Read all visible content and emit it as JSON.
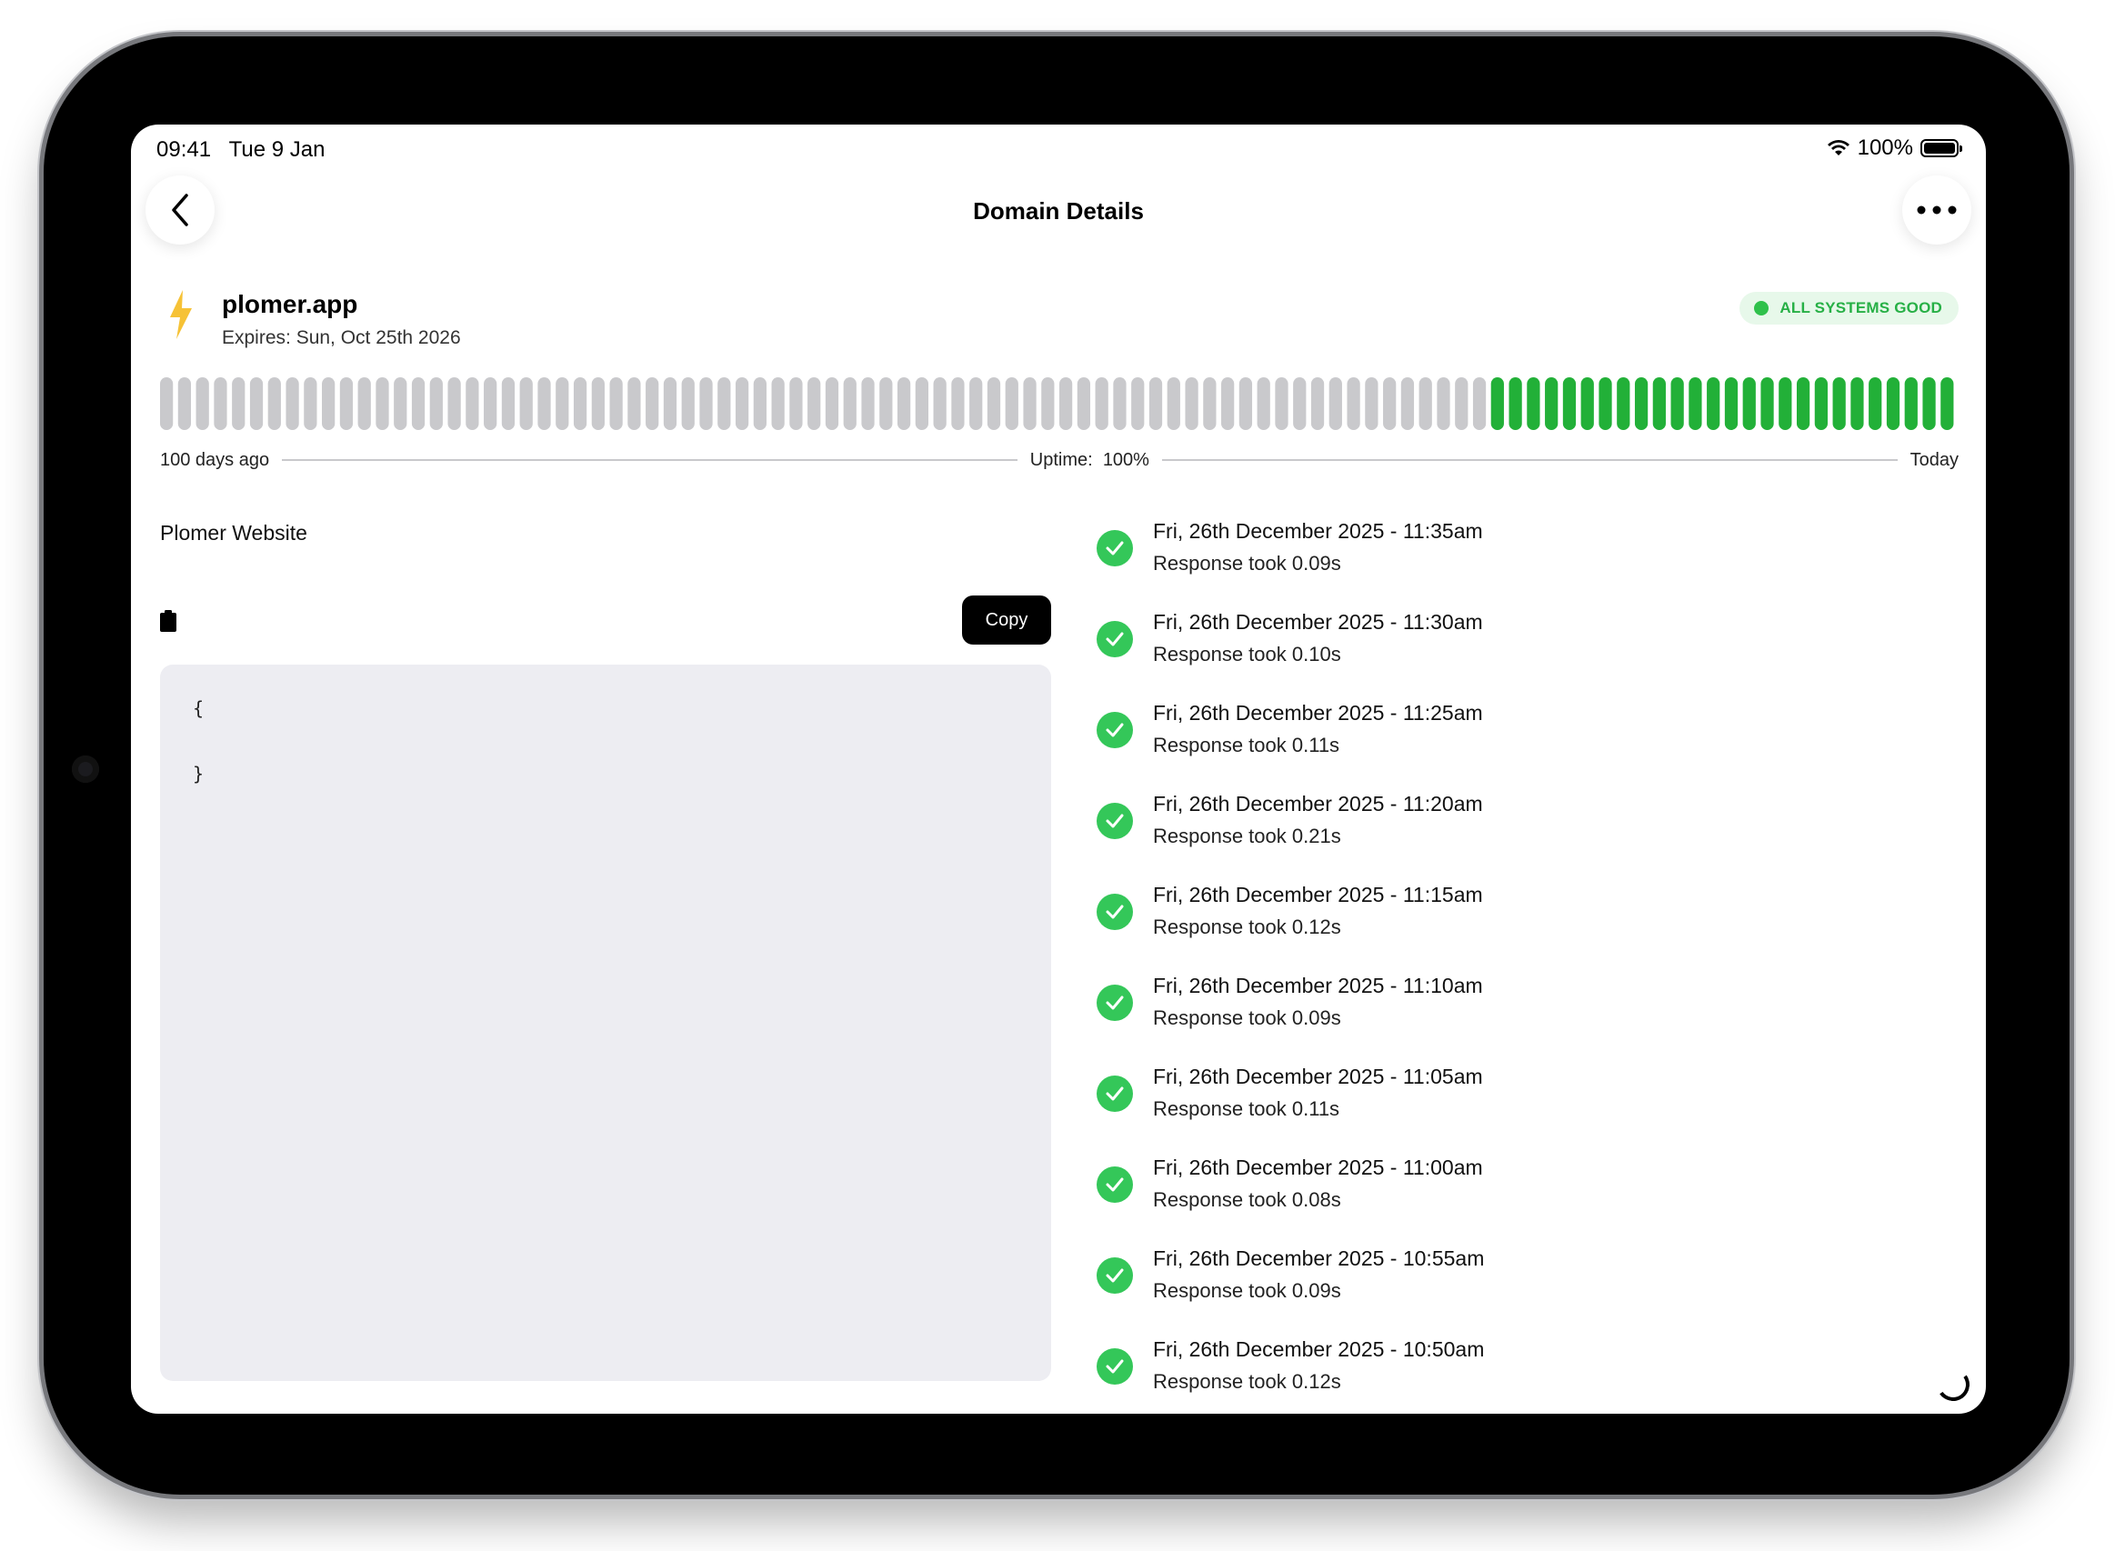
{
  "status_bar": {
    "time": "09:41",
    "date": "Tue 9 Jan",
    "battery": "100%"
  },
  "nav": {
    "title": "Domain Details"
  },
  "domain": {
    "name": "plomer.app",
    "expires": "Expires: Sun, Oct 25th 2026",
    "status_badge": "ALL SYSTEMS GOOD"
  },
  "uptime": {
    "start_label": "100 days ago",
    "uptime_label": "Uptime:",
    "uptime_value": "100%",
    "end_label": "Today",
    "days": 100,
    "no_data_days": 74,
    "up_days": 26,
    "colors": {
      "no_data": "#c9c9cc",
      "up": "#22b038"
    }
  },
  "section": {
    "title": "Plomer Website",
    "copy_label": "Copy"
  },
  "code": {
    "lines": [
      "{",
      "}"
    ]
  },
  "logs": [
    {
      "time": "Fri, 26th December 2025 - 11:35am",
      "response": "Response took 0.09s"
    },
    {
      "time": "Fri, 26th December 2025 - 11:30am",
      "response": "Response took 0.10s"
    },
    {
      "time": "Fri, 26th December 2025 - 11:25am",
      "response": "Response took 0.11s"
    },
    {
      "time": "Fri, 26th December 2025 - 11:20am",
      "response": "Response took 0.21s"
    },
    {
      "time": "Fri, 26th December 2025 - 11:15am",
      "response": "Response took 0.12s"
    },
    {
      "time": "Fri, 26th December 2025 - 11:10am",
      "response": "Response took 0.09s"
    },
    {
      "time": "Fri, 26th December 2025 - 11:05am",
      "response": "Response took 0.11s"
    },
    {
      "time": "Fri, 26th December 2025 - 11:00am",
      "response": "Response took 0.08s"
    },
    {
      "time": "Fri, 26th December 2025 - 10:55am",
      "response": "Response took 0.09s"
    },
    {
      "time": "Fri, 26th December 2025 - 10:50am",
      "response": "Response took 0.12s"
    }
  ]
}
